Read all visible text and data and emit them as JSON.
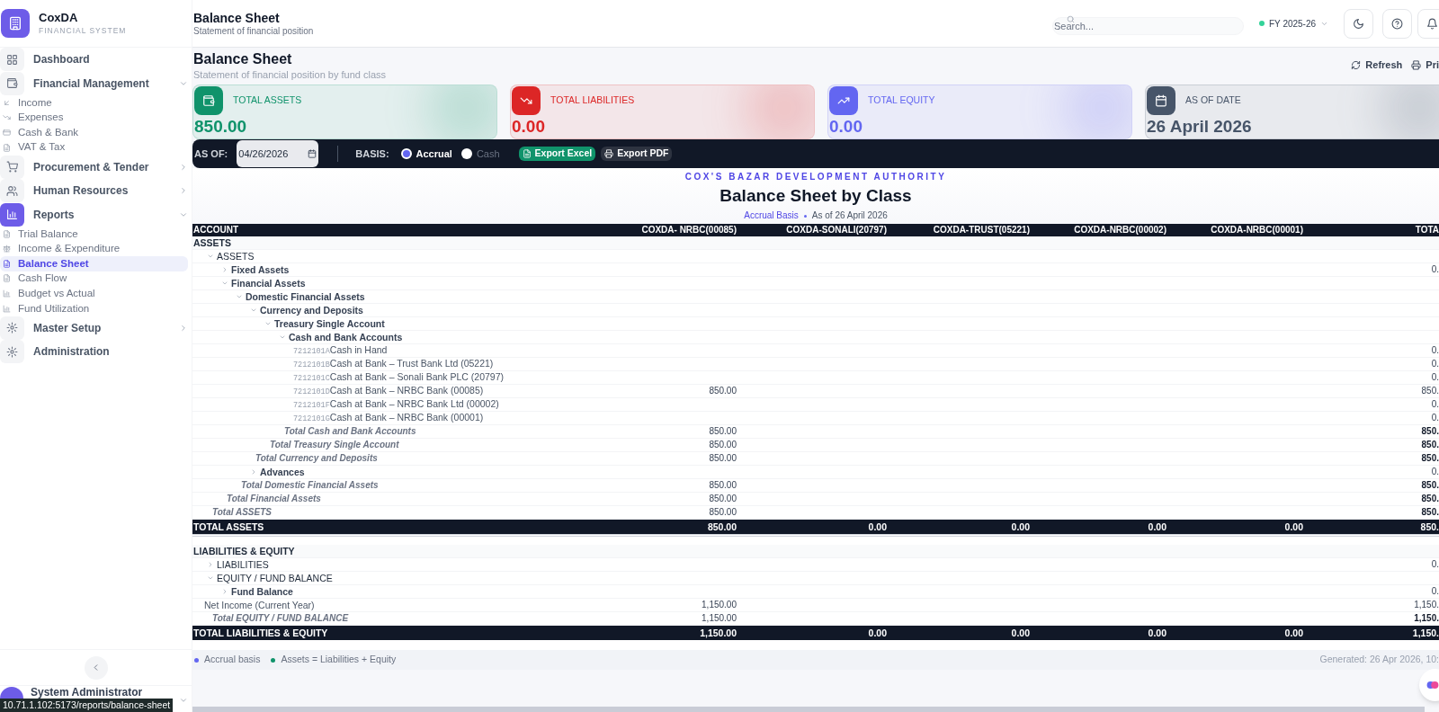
{
  "sidebar": {
    "brand": {
      "name": "CoxDA",
      "tagline": "FINANCIAL SYSTEM"
    },
    "items": [
      {
        "label": "Dashboard",
        "selected": false
      },
      {
        "label": "Financial Management",
        "selected": false,
        "expanded": true,
        "children": [
          {
            "label": "Income",
            "selected": false
          },
          {
            "label": "Expenses",
            "selected": false
          },
          {
            "label": "Cash & Bank",
            "selected": false
          },
          {
            "label": "VAT & Tax",
            "selected": false
          }
        ]
      },
      {
        "label": "Procurement & Tender",
        "selected": false,
        "expanded": false
      },
      {
        "label": "Human Resources",
        "selected": false,
        "expanded": false
      },
      {
        "label": "Reports",
        "selected": true,
        "expanded": true,
        "children": [
          {
            "label": "Trial Balance",
            "selected": false
          },
          {
            "label": "Income & Expenditure",
            "selected": false
          },
          {
            "label": "Balance Sheet",
            "selected": true
          },
          {
            "label": "Cash Flow",
            "selected": false
          },
          {
            "label": "Budget vs Actual",
            "selected": false
          },
          {
            "label": "Fund Utilization",
            "selected": false
          }
        ]
      },
      {
        "label": "Master Setup",
        "selected": false,
        "expanded": false
      },
      {
        "label": "Administration",
        "selected": false
      }
    ],
    "user": {
      "name": "System Administrator"
    }
  },
  "status_bar": {
    "url": "10.71.1.102:5173/reports/balance-sheet"
  },
  "header": {
    "title": "Balance Sheet",
    "subtitle": "Statement of financial position",
    "search": {
      "placeholder": "Search..."
    },
    "fiscal_year": "FY 2025-26"
  },
  "page": {
    "title": "Balance Sheet",
    "subtitle": "Statement of financial position by fund class",
    "actions": [
      "Refresh",
      "Pri"
    ]
  },
  "stats": [
    {
      "label": "TOTAL ASSETS",
      "value": "850.00",
      "color": "#10936b"
    },
    {
      "label": "TOTAL LIABILITIES",
      "value": "0.00",
      "color": "#dc2626"
    },
    {
      "label": "TOTAL EQUITY",
      "value": "0.00",
      "color": "#6366f1"
    },
    {
      "label": "AS OF DATE",
      "value": "26 April 2026",
      "color": "#475569"
    }
  ],
  "toolbar": {
    "as_of_label": "AS OF:",
    "date": "04/26/2026",
    "basis_label": "BASIS:",
    "basis_options": [
      {
        "label": "Accrual",
        "selected": true
      },
      {
        "label": "Cash",
        "selected": false
      }
    ],
    "exports": [
      "Export Excel",
      "Export PDF"
    ]
  },
  "report": {
    "org": "COX'S BAZAR DEVELOPMENT AUTHORITY",
    "title": "Balance Sheet by Class",
    "basis": "Accrual Basis",
    "as_of": "As of 26 April 2026",
    "columns": [
      "ACCOUNT",
      "COXDA- NRBC(00085)",
      "COXDA-SONALI(20797)",
      "COXDA-TRUST(05221)",
      "COXDA-NRBC(00002)",
      "COXDA-NRBC(00001)",
      "TOTA"
    ],
    "sections": [
      {
        "label": "ASSETS",
        "children": [
          {
            "kind": "group",
            "label": "ASSETS",
            "expanded": true,
            "children": [
              {
                "kind": "group",
                "label": "Fixed Assets",
                "expanded": false,
                "amounts": {
                  "total": "0."
                }
              },
              {
                "kind": "group",
                "label": "Financial Assets",
                "expanded": true,
                "children": [
                  {
                    "kind": "group",
                    "label": "Domestic Financial Assets",
                    "expanded": true,
                    "children": [
                      {
                        "kind": "group",
                        "label": "Currency and Deposits",
                        "expanded": true,
                        "children": [
                          {
                            "kind": "group",
                            "label": "Treasury Single Account",
                            "expanded": true,
                            "children": [
                              {
                                "kind": "group",
                                "label": "Cash and Bank Accounts",
                                "expanded": true,
                                "children": [
                                  {
                                    "kind": "account",
                                    "code": "7212101A",
                                    "label": "Cash in Hand",
                                    "amounts": {
                                      "total": "0."
                                    }
                                  },
                                  {
                                    "kind": "account",
                                    "code": "7212101B",
                                    "label": "Cash at Bank – Trust Bank Ltd (05221)",
                                    "amounts": {
                                      "total": "0."
                                    }
                                  },
                                  {
                                    "kind": "account",
                                    "code": "7212101C",
                                    "label": "Cash at Bank – Sonali Bank PLC (20797)",
                                    "amounts": {
                                      "total": "0."
                                    }
                                  },
                                  {
                                    "kind": "account",
                                    "code": "7212101D",
                                    "label": "Cash at Bank – NRBC Bank (00085)",
                                    "amounts": {
                                      "col_1": "850.00",
                                      "total": "850."
                                    }
                                  },
                                  {
                                    "kind": "account",
                                    "code": "7212101F",
                                    "label": "Cash at Bank – NRBC Bank Ltd (00002)",
                                    "amounts": {
                                      "total": "0."
                                    }
                                  },
                                  {
                                    "kind": "account",
                                    "code": "7212101G",
                                    "label": "Cash at Bank – NRBC Bank (00001)",
                                    "amounts": {
                                      "total": "0."
                                    }
                                  }
                                ],
                                "total": {
                                  "label": "Total Cash and Bank Accounts",
                                  "amounts": {
                                    "col_1": "850.00",
                                    "total": "850."
                                  }
                                }
                              }
                            ],
                            "total": {
                              "label": "Total Treasury Single Account",
                              "amounts": {
                                "col_1": "850.00",
                                "total": "850."
                              }
                            }
                          }
                        ],
                        "total": {
                          "label": "Total Currency and Deposits",
                          "amounts": {
                            "col_1": "850.00",
                            "total": "850."
                          }
                        }
                      },
                      {
                        "kind": "group",
                        "label": "Advances",
                        "expanded": false,
                        "amounts": {
                          "total": "0."
                        }
                      }
                    ],
                    "total": {
                      "label": "Total Domestic Financial Assets",
                      "amounts": {
                        "col_1": "850.00",
                        "total": "850."
                      }
                    }
                  }
                ],
                "total": {
                  "label": "Total Financial Assets",
                  "amounts": {
                    "col_1": "850.00",
                    "total": "850."
                  }
                }
              }
            ],
            "total": {
              "label": "Total ASSETS",
              "amounts": {
                "col_1": "850.00",
                "total": "850."
              }
            }
          }
        ],
        "grand_total": {
          "label": "TOTAL ASSETS",
          "amounts": {
            "col_1": "850.00",
            "col_2": "0.00",
            "col_3": "0.00",
            "col_4": "0.00",
            "col_5": "0.00",
            "total": "850."
          }
        }
      },
      {
        "label": "LIABILITIES & EQUITY",
        "children": [
          {
            "kind": "group",
            "label": "LIABILITIES",
            "expanded": false,
            "amounts": {
              "total": "0."
            }
          },
          {
            "kind": "group",
            "label": "EQUITY / FUND BALANCE",
            "expanded": true,
            "children": [
              {
                "kind": "group",
                "label": "Fund Balance",
                "expanded": false,
                "amounts": {
                  "total": "0."
                }
              },
              {
                "kind": "line",
                "label": "Net Income (Current Year)",
                "amounts": {
                  "col_1": "1,150.00",
                  "total": "1,150."
                }
              }
            ],
            "total": {
              "label": "Total EQUITY / FUND BALANCE",
              "amounts": {
                "col_1": "1,150.00",
                "total": "1,150."
              }
            }
          }
        ],
        "grand_total": {
          "label": "TOTAL LIABILITIES & EQUITY",
          "amounts": {
            "col_1": "1,150.00",
            "col_2": "0.00",
            "col_3": "0.00",
            "col_4": "0.00",
            "col_5": "0.00",
            "total": "1,150."
          }
        }
      }
    ]
  },
  "footer": {
    "legend": [
      {
        "label": "Accrual basis",
        "color": "#6366f1"
      },
      {
        "label": "Assets = Liabilities + Equity",
        "color": "#10936b"
      }
    ],
    "generated": "Generated: 26 Apr 2026, 10:"
  }
}
